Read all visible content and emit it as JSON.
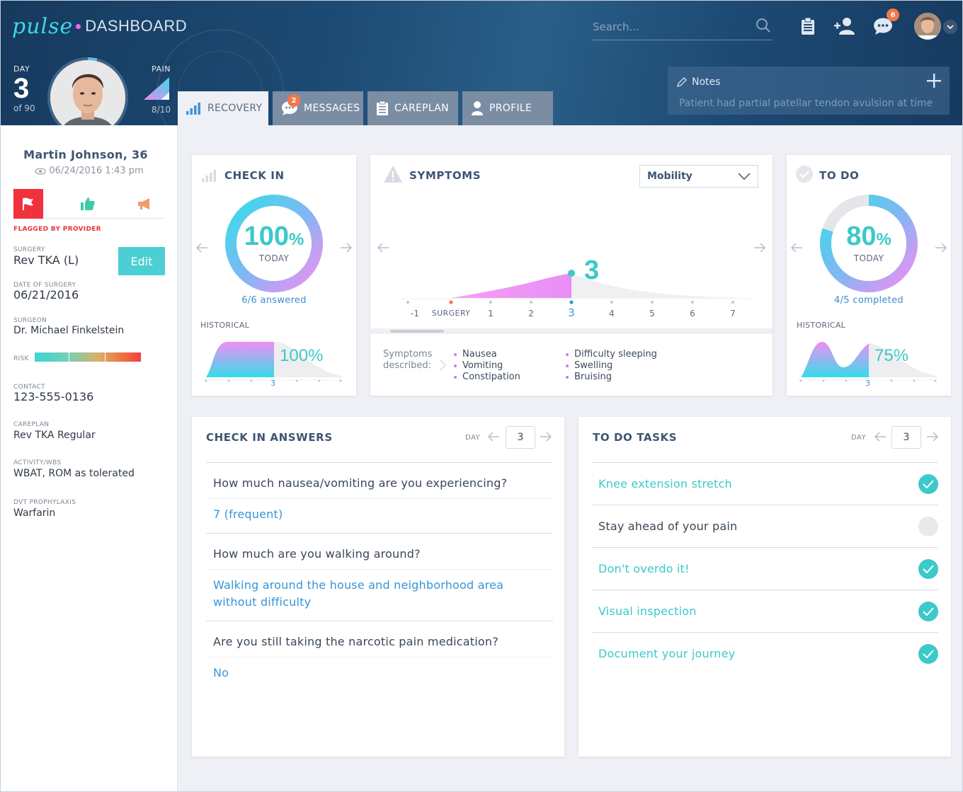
{
  "app": {
    "logo": "pulse",
    "title": "DASHBOARD"
  },
  "header": {
    "search_placeholder": "Search...",
    "icons": [
      "clipboard-icon",
      "add-user-icon",
      "chat-icon",
      "avatar"
    ],
    "chat_badge": "6"
  },
  "patient": {
    "day_label": "DAY",
    "day": "3",
    "day_of": "of 90",
    "pain_label": "PAIN",
    "pain": "8/10",
    "name": "Martin Johnson, 36",
    "last_seen": "06/24/2016 1:43 pm",
    "flagged_label": "FLAGGED BY PROVIDER",
    "fields": {
      "surgery_label": "SURGERY",
      "surgery": "Rev TKA (L)",
      "dos_label": "DATE OF SURGERY",
      "dos": "06/21/2016",
      "surgeon_label": "SURGEON",
      "surgeon": "Dr. Michael Finkelstein",
      "risk_label": "RISK",
      "contact_label": "CONTACT",
      "contact": "123-555-0136",
      "careplan_label": "CAREPLAN",
      "careplan": "Rev TKA Regular",
      "activity_label": "ACTIVITY/WBS",
      "activity": "WBAT, ROM as tolerated",
      "dvt_label": "DVT PROPHYLAXIS",
      "dvt": "Warfarin"
    },
    "edit_label": "Edit"
  },
  "tabs": [
    {
      "label": "RECOVERY",
      "active": true
    },
    {
      "label": "MESSAGES",
      "badge": "2"
    },
    {
      "label": "CAREPLAN"
    },
    {
      "label": "PROFILE"
    }
  ],
  "notes": {
    "title": "Notes",
    "text": "Patient had partial patellar tendon avulsion at time"
  },
  "checkin": {
    "title": "CHECK IN",
    "percent": "100",
    "pct_sign": "%",
    "today": "TODAY",
    "caption": "6/6 answered",
    "hist_label": "HISTORICAL",
    "hist_value": "100%",
    "hist_day": "3",
    "fraction": 1.0
  },
  "symptoms": {
    "title": "SYMPTOMS",
    "dropdown": "Mobility",
    "current": "3",
    "axis": [
      "-1",
      "SURGERY",
      "1",
      "2",
      "3",
      "4",
      "5",
      "6",
      "7"
    ],
    "described_label": "Symptoms described:",
    "col1": [
      "Nausea",
      "Vomiting",
      "Constipation"
    ],
    "col2": [
      "Difficulty sleeping",
      "Swelling",
      "Bruising"
    ]
  },
  "todo": {
    "title": "TO DO",
    "percent": "80",
    "pct_sign": "%",
    "today": "TODAY",
    "caption": "4/5 completed",
    "hist_label": "HISTORICAL",
    "hist_value": "75%",
    "hist_day": "3",
    "fraction": 0.8
  },
  "answers": {
    "title": "CHECK IN ANSWERS",
    "day_label": "DAY",
    "day": "3",
    "items": [
      {
        "q": "How much nausea/vomiting are you experiencing?",
        "a": "7 (frequent)"
      },
      {
        "q": "How much are you walking around?",
        "a": "Walking around the house and neighborhood area without difficulty"
      },
      {
        "q": "Are you still taking the narcotic pain medication?",
        "a": "No"
      }
    ]
  },
  "tasks": {
    "title": "TO DO TASKS",
    "day_label": "DAY",
    "day": "3",
    "items": [
      {
        "label": "Knee extension stretch",
        "done": true
      },
      {
        "label": "Stay ahead of your pain",
        "done": false
      },
      {
        "label": "Don't overdo it!",
        "done": true
      },
      {
        "label": "Visual inspection",
        "done": true
      },
      {
        "label": "Document your journey",
        "done": true
      }
    ]
  },
  "colors": {
    "accent": "#3cc9c9",
    "link": "#3795d8",
    "flag": "#f0323d",
    "badge": "#f4774b"
  }
}
